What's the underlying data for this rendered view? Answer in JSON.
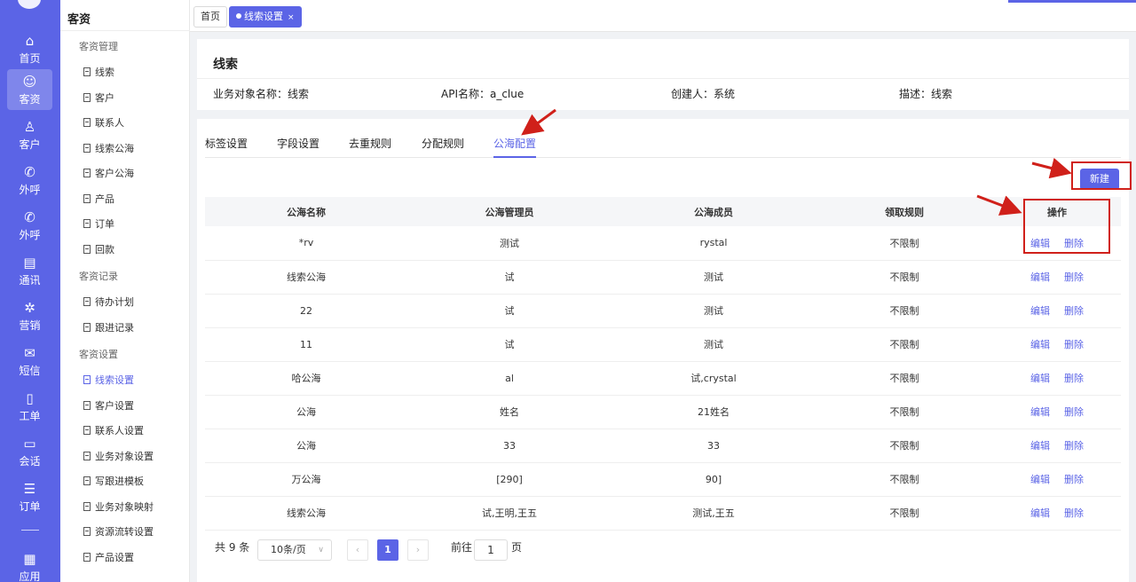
{
  "rail": {
    "items": [
      {
        "label": "首页",
        "icon": "home-icon",
        "glyph": "⌂"
      },
      {
        "label": "客资",
        "icon": "users-icon",
        "glyph": "☺"
      },
      {
        "label": "客户",
        "icon": "person-icon",
        "glyph": "♙"
      },
      {
        "label": "外呼",
        "icon": "phone-outgoing-icon",
        "glyph": "✆"
      },
      {
        "label": "外呼",
        "icon": "phone-call-icon",
        "glyph": "✆"
      },
      {
        "label": "通讯",
        "icon": "contacts-icon",
        "glyph": "▤"
      },
      {
        "label": "营销",
        "icon": "marketing-icon",
        "glyph": "✲"
      },
      {
        "label": "短信",
        "icon": "sms-icon",
        "glyph": "✉"
      },
      {
        "label": "工单",
        "icon": "clipboard-icon",
        "glyph": "▯"
      },
      {
        "label": "会话",
        "icon": "chat-icon",
        "glyph": "▭"
      },
      {
        "label": "订单",
        "icon": "order-list-icon",
        "glyph": "☰"
      },
      {
        "label": "应用",
        "icon": "app-store-icon",
        "glyph": "▦"
      }
    ]
  },
  "menu": {
    "title": "客资",
    "groups": [
      {
        "label": "客资管理",
        "items": [
          "线索",
          "客户",
          "联系人",
          "线索公海",
          "客户公海",
          "产品",
          "订单",
          "回款"
        ]
      },
      {
        "label": "客资记录",
        "items": [
          "待办计划",
          "跟进记录"
        ]
      },
      {
        "label": "客资设置",
        "items": [
          "线索设置",
          "客户设置",
          "联系人设置",
          "业务对象设置",
          "写跟进模板",
          "业务对象映射",
          "资源流转设置",
          "产品设置"
        ]
      }
    ],
    "active": "线索设置"
  },
  "page_tabs": {
    "home": "首页",
    "current": "线索设置",
    "close": "×"
  },
  "info": {
    "title": "线索",
    "object_name": "业务对象名称：线索",
    "api_name": "API名称：a_clue",
    "creator": "创建人：系统",
    "description": "描述：线索"
  },
  "tabs": [
    "标签设置",
    "字段设置",
    "去重规则",
    "分配规则",
    "公海配置"
  ],
  "active_tab": "公海配置",
  "new_button": "新建",
  "table": {
    "headers": [
      "公海名称",
      "公海管理员",
      "公海成员",
      "领取规则",
      "操作"
    ],
    "rows": [
      [
        "*rv",
        "测试",
        "rystal",
        "不限制"
      ],
      [
        "线索公海",
        "试",
        "测试",
        "不限制"
      ],
      [
        "22",
        "试",
        "测试",
        "不限制"
      ],
      [
        "11",
        "试",
        "测试",
        "不限制"
      ],
      [
        "哈公海",
        "al",
        "试,crystal",
        "不限制"
      ],
      [
        "公海",
        "姓名",
        "21姓名",
        "不限制"
      ],
      [
        "公海",
        "33",
        "33",
        "不限制"
      ],
      [
        "万公海",
        "[290]",
        "90]",
        "不限制"
      ],
      [
        "线索公海",
        "试,王明,王五",
        "测试,王五",
        "不限制"
      ]
    ],
    "edit": "编辑",
    "delete": "删除"
  },
  "pagination": {
    "total": "共 9 条",
    "page_size": "10条/页",
    "current_page": "1",
    "prev": "‹",
    "next": "›",
    "goto_label": "前往",
    "goto_value": "1",
    "page_suffix": "页"
  },
  "colors": {
    "accent": "#5b64e6",
    "annotation": "#d0201a"
  }
}
